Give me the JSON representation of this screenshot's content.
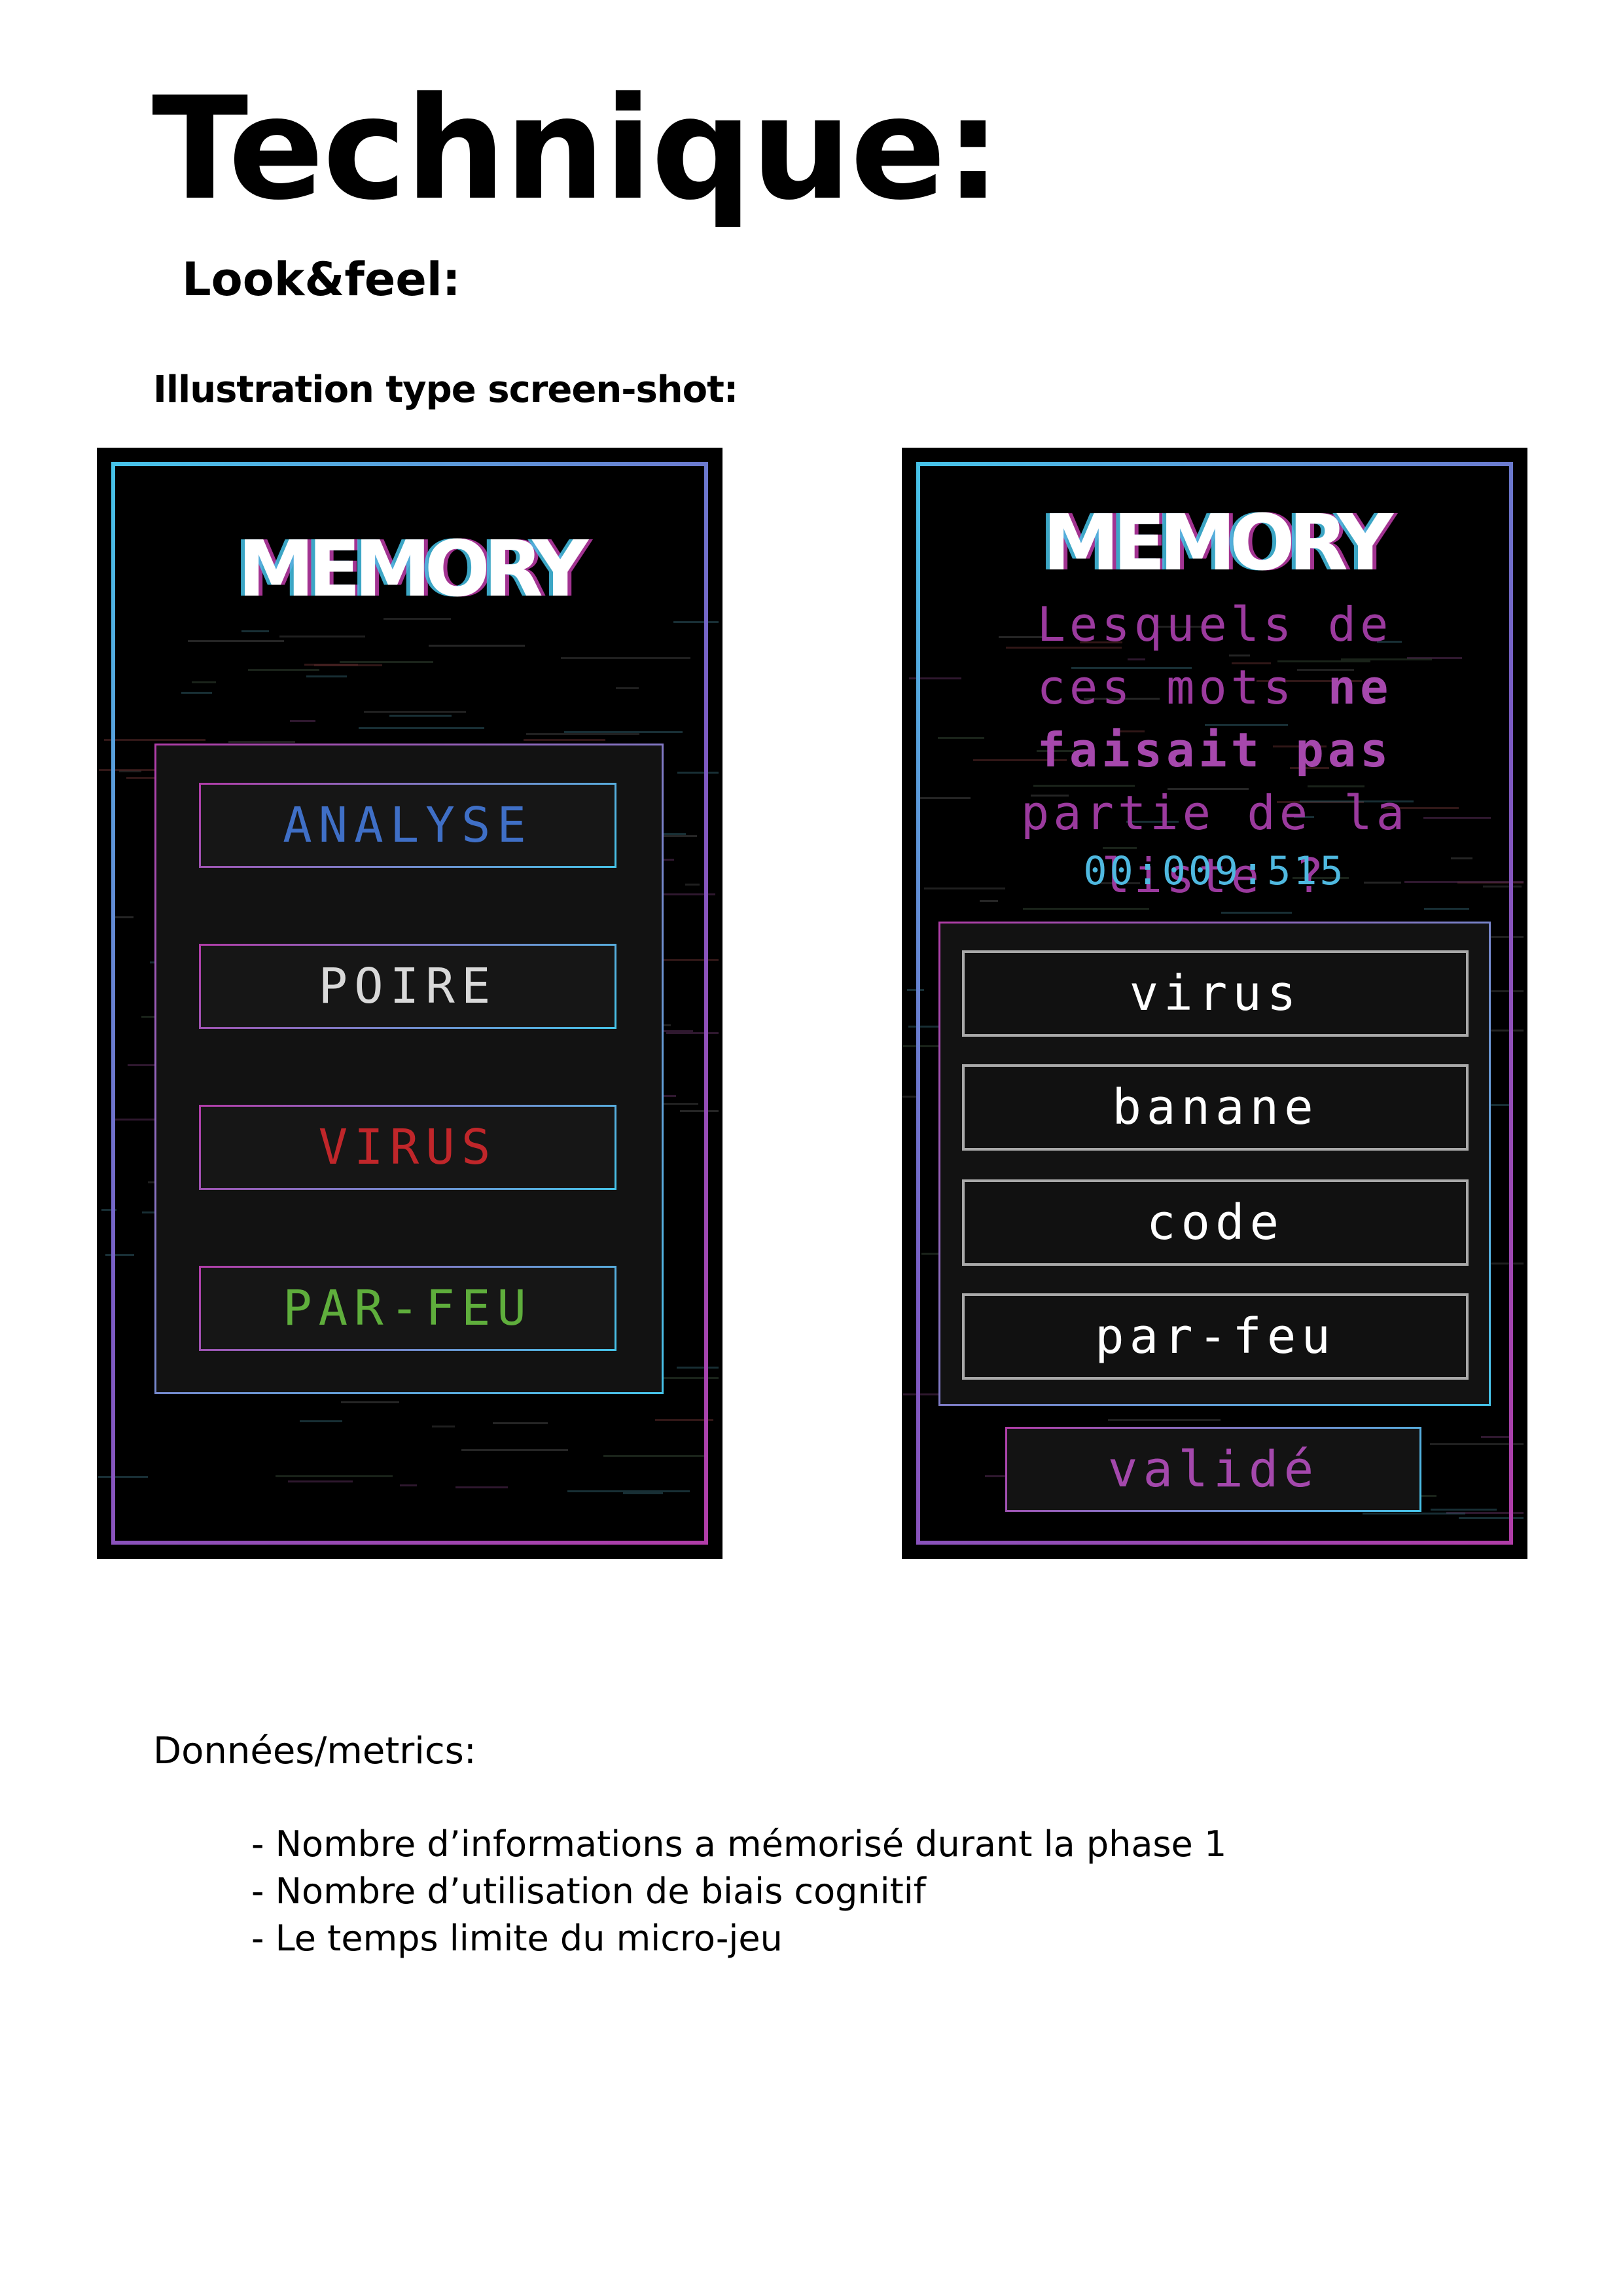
{
  "doc": {
    "title": "Technique:",
    "subtitle": "Look&feel:",
    "section_label": "Illustration type screen-shot:"
  },
  "screen_left": {
    "logo": "MEMORY",
    "words": [
      {
        "label": "ANALYSE",
        "color": "#3f6fc6"
      },
      {
        "label": "POIRE",
        "color": "#d9d9d9"
      },
      {
        "label": "VIRUS",
        "color": "#c0262a"
      },
      {
        "label": "PAR-FEU",
        "color": "#5fae3c"
      }
    ]
  },
  "screen_right": {
    "logo": "MEMORY",
    "question": {
      "part1": "Lesquels de ces mots ",
      "bold": "ne faisait pas",
      "part2": " partie de la liste ?"
    },
    "timer": "00:009:515",
    "answers": [
      "virus",
      "banane",
      "code",
      "par-feu"
    ],
    "validate_label": "validé"
  },
  "metrics": {
    "title": "Données/metrics:",
    "items": [
      "- Nombre d’informations a mémorisé durant la phase 1",
      "- Nombre d’utilisation de biais cognitif",
      "- Le temps limite du micro-jeu"
    ]
  },
  "colors": {
    "frame_cyan": "#46c3e8",
    "frame_magenta": "#b13da8",
    "question_purple": "#9b3a9e",
    "timer_blue": "#4fb9e0"
  }
}
